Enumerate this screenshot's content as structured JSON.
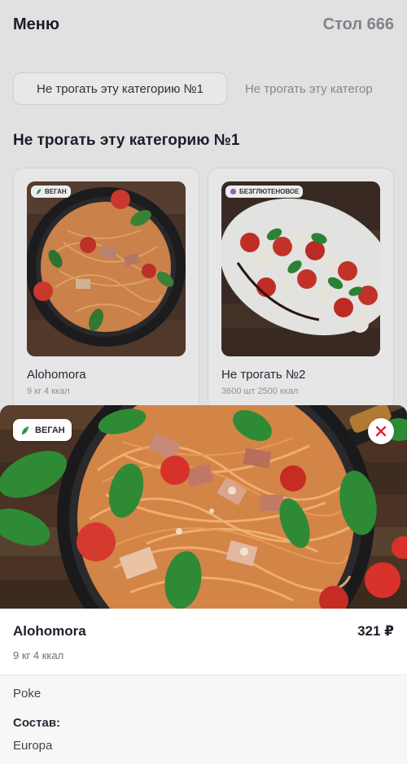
{
  "header": {
    "title": "Меню",
    "table": "Стол 666"
  },
  "tabs": [
    {
      "label": "Не трогать эту категорию №1",
      "active": true
    },
    {
      "label": "Не трогать эту категор",
      "active": false
    }
  ],
  "section": {
    "title": "Не трогать эту категорию №1"
  },
  "cards": [
    {
      "badge": "ВЕГАН",
      "badge_icon": "leaf-icon",
      "name": "Alohomora",
      "meta": "9 кг 4 ккал"
    },
    {
      "badge": "БЕЗГЛЮТЕНОВОЕ",
      "badge_icon": "wheat-icon",
      "name": "Не трогать №2",
      "meta": "3600 шт 2500 ккал"
    }
  ],
  "detail": {
    "badge": "ВЕГАН",
    "badge_icon": "leaf-icon",
    "name": "Alohomora",
    "price": "321 ₽",
    "meta": "9 кг 4 ккал",
    "description": "Poke",
    "composition_label": "Состав:",
    "composition_value": "Europa",
    "close_icon": "close-icon"
  },
  "colors": {
    "accent_red": "#e0203a",
    "leaf_green": "#3aa24a"
  }
}
